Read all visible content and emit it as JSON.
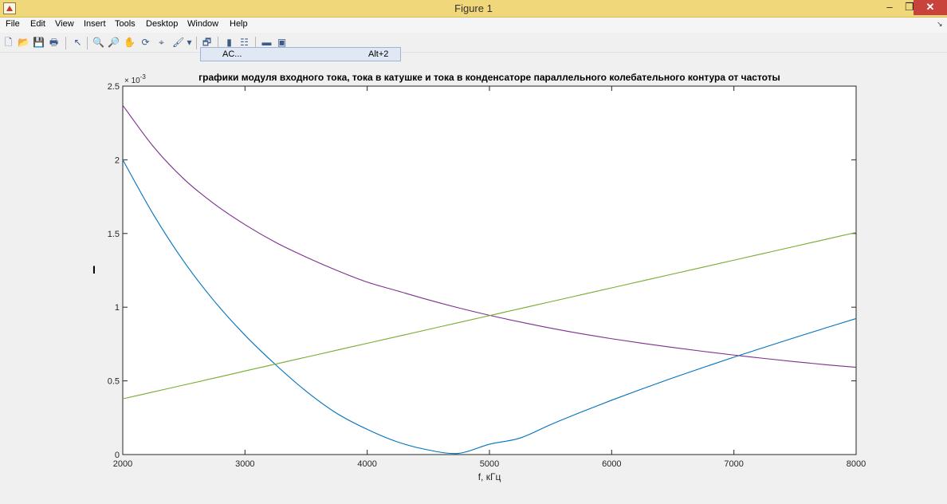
{
  "window": {
    "title": "Figure 1",
    "min_glyph": "–",
    "max_glyph": "❐",
    "close_glyph": "✕"
  },
  "menu": {
    "items": [
      "File",
      "Edit",
      "View",
      "Insert",
      "Tools",
      "Desktop",
      "Window",
      "Help"
    ],
    "overflow_glyph": "↘"
  },
  "toolbar": {
    "icons": [
      "new-figure-icon",
      "open-file-icon",
      "save-icon",
      "print-icon",
      "pointer-icon",
      "zoom-in-icon",
      "zoom-out-icon",
      "pan-icon",
      "rotate-3d-icon",
      "data-cursor-icon",
      "brush-icon",
      "brush-dropdown-icon",
      "link-plot-icon",
      "colorbar-icon",
      "legend-icon",
      "hide-plot-tools-icon",
      "show-plot-tools-icon"
    ],
    "glyphs": [
      "🗋",
      "📂",
      "💾",
      "🖶",
      "↖",
      "🔍",
      "🔎",
      "✋",
      "⟳",
      "⌖",
      "🖌",
      "▾",
      "🗗",
      "▮",
      "☷",
      "▬",
      "▣"
    ]
  },
  "popup": {
    "label": "AC...",
    "shortcut": "Alt+2"
  },
  "chart_data": {
    "type": "line",
    "title": "графики модуля входного тока, тока в катушке и тока в конденсаторе параллельного колебательного контура от частоты",
    "xlabel": "f, кГц",
    "ylabel": "I",
    "y_exponent_label": "× 10",
    "y_exponent_power": "-3",
    "xlim": [
      2000,
      8000
    ],
    "ylim": [
      0,
      0.0025
    ],
    "x_ticks": [
      2000,
      3000,
      4000,
      5000,
      6000,
      7000,
      8000
    ],
    "x_tick_labels": [
      "2000",
      "3000",
      "4000",
      "5000",
      "6000",
      "7000",
      "8000"
    ],
    "y_ticks": [
      0,
      0.0005,
      0.001,
      0.0015,
      0.002,
      0.0025
    ],
    "y_tick_labels": [
      "0",
      "0.5",
      "1",
      "1.5",
      "2",
      "2.5"
    ],
    "grid": false,
    "x": [
      2000,
      2250,
      2500,
      2750,
      3000,
      3250,
      3500,
      3750,
      4000,
      4250,
      4500,
      4750,
      5000,
      5250,
      5500,
      5750,
      6000,
      6250,
      6500,
      6750,
      7000,
      7250,
      7500,
      7750,
      8000
    ],
    "series": [
      {
        "color": "#0072bd",
        "values": [
          0.002,
          0.00163,
          0.00131,
          0.00104,
          0.00081,
          0.00061,
          0.00043,
          0.00028,
          0.000171,
          8.5e-05,
          3.1e-05,
          8.5e-06,
          7e-05,
          0.000112,
          0.000203,
          0.000288,
          0.000369,
          0.000446,
          0.00052,
          0.000591,
          0.000661,
          0.000728,
          0.000794,
          0.000859,
          0.000923
        ]
      },
      {
        "color": "#7e2f8e",
        "values": [
          0.00237,
          0.00209,
          0.00187,
          0.0017,
          0.00156,
          0.00144,
          0.00134,
          0.00125,
          0.00117,
          0.00111,
          0.00105,
          0.000995,
          0.000945,
          0.0009,
          0.000858,
          0.00082,
          0.000786,
          0.000755,
          0.000727,
          0.0007,
          0.000675,
          0.000652,
          0.00063,
          0.00061,
          0.000592
        ]
      },
      {
        "color": "#77ac30",
        "values": [
          0.000378,
          0.000425,
          0.000472,
          0.000519,
          0.000567,
          0.000614,
          0.000661,
          0.000708,
          0.000755,
          0.000802,
          0.000849,
          0.000896,
          0.000943,
          0.00099,
          0.001037,
          0.001084,
          0.001131,
          0.001178,
          0.001225,
          0.001272,
          0.001319,
          0.001366,
          0.001413,
          0.00146,
          0.001507
        ]
      }
    ]
  }
}
